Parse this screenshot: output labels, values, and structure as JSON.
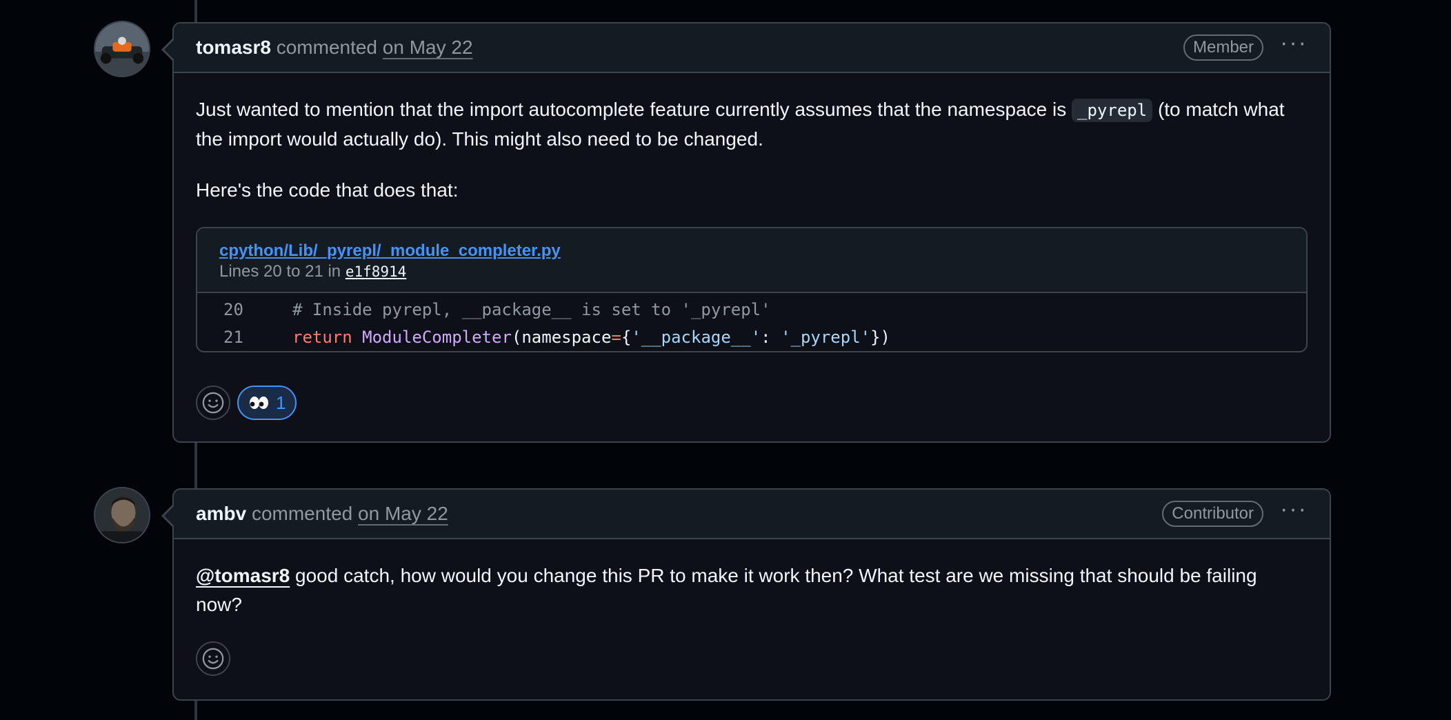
{
  "comments": [
    {
      "author": "tomasr8",
      "action": "commented",
      "date": "on May 22",
      "role": "Member",
      "menu": "···",
      "paragraphs": {
        "p1_pre": "Just wanted to mention that the import autocomplete feature currently assumes that the namespace is ",
        "p1_code": "_pyrepl",
        "p1_post": " (to match what the import would actually do). This might also need to be changed.",
        "p2": "Here's the code that does that:"
      },
      "snippet": {
        "path": "cpython/Lib/_pyrepl/_module_completer.py",
        "meta_pre": "Lines 20 to 21 in ",
        "commit": "e1f8914",
        "lines": [
          {
            "no": "20",
            "text": "# Inside pyrepl, __package__ is set to '_pyrepl'"
          },
          {
            "no": "21",
            "kw": "return",
            "fn": "ModuleCompleter",
            "p1": "(namespace",
            "op": "=",
            "p2": "{",
            "s1": "'__package__'",
            "p3": ": ",
            "s2": "'_pyrepl'",
            "p4": "})"
          }
        ]
      },
      "reactions": [
        {
          "emoji": "eyes",
          "count": "1"
        }
      ]
    },
    {
      "author": "ambv",
      "action": "commented",
      "date": "on May 22",
      "role": "Contributor",
      "menu": "···",
      "mention": "@tomasr8",
      "text": " good catch, how would you change this PR to make it work then? What test are we missing that should be failing now?"
    }
  ],
  "icons": {
    "emoji_picker": "smiley-icon",
    "eyes": "eyes-icon",
    "menu": "kebab-horizontal-icon"
  },
  "colors": {
    "background": "#010409",
    "card": "#0d1117",
    "header": "#151b23",
    "border": "#3d444d",
    "link": "#4493f8"
  }
}
